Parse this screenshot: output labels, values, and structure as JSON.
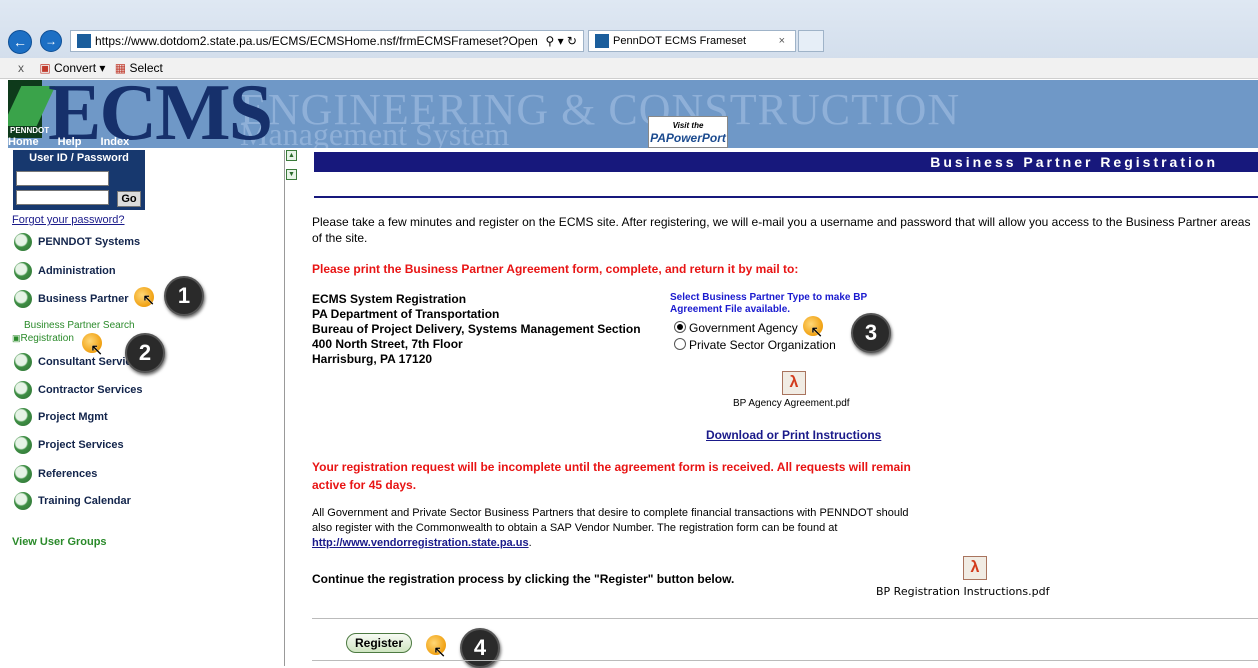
{
  "browser": {
    "url": "https://www.dotdom2.state.pa.us/ECMS/ECMSHome.nsf/frmECMSFrameset?Open",
    "tab_title": "PennDOT ECMS Frameset",
    "tab_close": "×",
    "search_icon": "search-icon",
    "toolbar": {
      "close": "x",
      "convert": "Convert",
      "select": "Select"
    }
  },
  "banner": {
    "logo_text": "ECMS",
    "line1": "ENGINEERING & CONSTRUCTION",
    "line2": "Management   System",
    "penndot": "PENNDOT",
    "powerport_top": "Visit the",
    "powerport_brand": "PAPowerPort",
    "nav": [
      "Home",
      "Help",
      "Index"
    ]
  },
  "sidebar": {
    "login_title": "User ID / Password",
    "go_label": "Go",
    "forgot": "Forgot your password?",
    "items": [
      "PENNDOT Systems",
      "Administration",
      "Business Partner",
      "Consultant Services",
      "Contractor Services",
      "Project Mgmt",
      "Project Services",
      "References",
      "Training Calendar"
    ],
    "sub_search": "Business Partner Search",
    "sub_registration": "Registration",
    "view_user_groups": "View User Groups"
  },
  "steps": [
    "1",
    "2",
    "3",
    "4"
  ],
  "main": {
    "header": "Business Partner Registration",
    "intro": "Please take a few minutes and register on the ECMS site. After registering, we will e-mail you a username and password that will allow you access to the Business Partner areas of the site.",
    "print_note": "Please print the Business Partner Agreement form, complete, and return it by mail to:",
    "address": [
      "ECMS System Registration",
      "PA Department of Transportation",
      "Bureau of Project Delivery, Systems Management Section",
      "400 North Street, 7th Floor",
      "Harrisburg, PA 17120"
    ],
    "bp_type_prompt": "Select Business Partner Type to make BP Agreement File available.",
    "radio_gov": "Government Agency",
    "radio_private": "Private Sector Organization",
    "agency_pdf": "BP Agency Agreement.pdf",
    "download_instructions": "Download or Print Instructions",
    "incomplete_notice": "Your registration request will be incomplete until the agreement form is received. All requests will remain active for 45 days.",
    "gov_text": "All Government and Private Sector Business Partners that desire to complete financial transactions with PENNDOT should also register with the Commonwealth to obtain a SAP Vendor Number. The registration form can be found at",
    "vendor_link": "http://www.vendorregistration.state.pa.us",
    "continue_text": "Continue the registration process by clicking the \"Register\" button below.",
    "reg_pdf": "BP Registration Instructions.pdf",
    "register_button": "Register"
  }
}
